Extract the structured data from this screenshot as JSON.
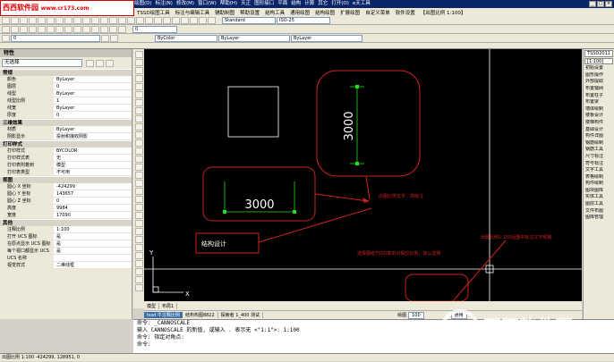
{
  "logo": {
    "site": "西西软件园",
    "url": "www.cr173.com"
  },
  "menu": [
    "TSSD绘图工具",
    "标注与编辑工具",
    "辅助制图",
    "帮助设置",
    "结构工具",
    "平面布置",
    "通用绘图",
    "结构绘图",
    "扩展绘图",
    "自定义菜单",
    "软件设置",
    "【出图比例 1:100】"
  ],
  "menu_right": [
    "绘图(D)",
    "标注(N)",
    "修改(M)",
    "窗口(W)",
    "帮助(H)",
    "天正",
    "图形接口",
    "平面",
    "结构",
    "计算",
    "其它",
    "打开(O)",
    "e天工具"
  ],
  "toolbar2": {
    "layer_combo": "0",
    "style_combo": "Standard",
    "dim_combo": "ISO-25"
  },
  "toolbar3": {
    "layer": "0",
    "linetype": "ByLayer",
    "lineweight": "ByLayer",
    "color": "ByColor"
  },
  "props": {
    "title": "特性",
    "selection": "无选择",
    "sections": [
      {
        "name": "常规",
        "rows": [
          [
            "颜色",
            "ByLayer"
          ],
          [
            "图层",
            "0"
          ],
          [
            "线型",
            "ByLayer"
          ],
          [
            "线型比例",
            "1"
          ],
          [
            "线宽",
            "ByLayer"
          ],
          [
            "厚度",
            "0"
          ]
        ]
      },
      {
        "name": "三维效果",
        "rows": [
          [
            "材质",
            "ByLayer"
          ],
          [
            "阴影显示",
            "投射和接收阴影"
          ]
        ]
      },
      {
        "name": "打印样式",
        "rows": [
          [
            "打印样式",
            "BYCOLOR"
          ],
          [
            "打印样式表",
            "无"
          ],
          [
            "打印表附着到",
            "模型"
          ],
          [
            "打印表类型",
            "不可用"
          ]
        ]
      },
      {
        "name": "视图",
        "rows": [
          [
            "圆心 X 坐标",
            "-424299"
          ],
          [
            "圆心 Y 坐标",
            "143657"
          ],
          [
            "圆心 Z 坐标",
            "0"
          ],
          [
            "高度",
            "9984"
          ],
          [
            "宽度",
            "17090"
          ]
        ]
      },
      {
        "name": "其他",
        "rows": [
          [
            "注释比例",
            "1:100"
          ],
          [
            "打开 UCS 图标",
            "是"
          ],
          [
            "在原点显示 UCS 图标",
            "是"
          ],
          [
            "每个视口都显示 UCS",
            "是"
          ],
          [
            "UCS 名称",
            ""
          ],
          [
            "视觉样式",
            "二维线框"
          ]
        ]
      }
    ]
  },
  "canvas": {
    "dim_vertical": "3000",
    "dim_horizontal": "3000",
    "design_label": "结构设计",
    "note1": "出图比例文字、高级注",
    "note2": "出图比例1:150后图中标注文字规格",
    "note3": "选择图纸TSSD菜单对相应比例，加以选择",
    "ucs_x": "X",
    "ucs_y": "Y",
    "accent_red": "#cc2222",
    "dim_green": "#22dd22"
  },
  "right_panel": [
    "TSSD2011",
    "[1:100]",
    "初始设置",
    "图形操作",
    "外部提取",
    "布置轴网",
    "布置柱子",
    "布置梁",
    "墙体绘制",
    "楼板设计",
    "楼梯构件",
    "基础设计",
    "构件详图",
    "钢筋绘制",
    "钢筋工具",
    "尺寸标注",
    "符号标注",
    "文字工具",
    "表格绘制",
    "构件绘制",
    "图块图库",
    "实体工具",
    "图层工具",
    "文件布图",
    "图库管理"
  ],
  "tabs": [
    "tssd 牛注释比例",
    "结构构图8822",
    "探索者 1_400 测试"
  ],
  "tabs_right": {
    "scale_label": "绘图",
    "scale_value": "1:100",
    "mode": "通用",
    "ratio": "100"
  },
  "layout_tabs": [
    "模型",
    "布局1"
  ],
  "cmd": [
    "命令: _CANNOSCALE",
    "输入 CANNOSCALE 的新值, 或输入 . 表示无 <\"1:1\">: 1:100",
    "命令: 指定对角点:",
    "命令:"
  ],
  "status": "出图比例 1:100    -424299, 128951, 0",
  "watermark": {
    "brand": "西西软件园",
    "url": "www.cr173.com"
  }
}
